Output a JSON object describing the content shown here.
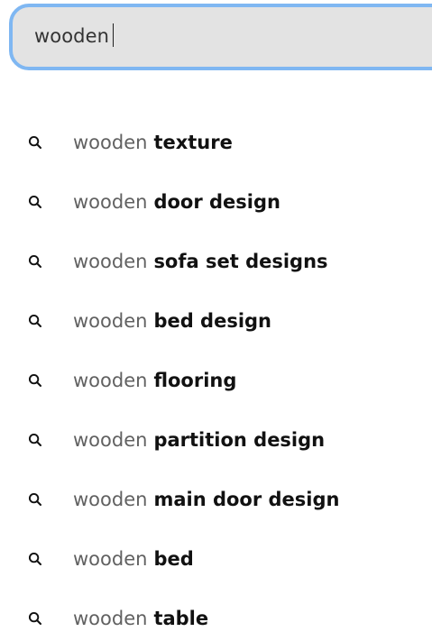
{
  "search": {
    "value": "wooden"
  },
  "suggestions": [
    {
      "prefix": "wooden",
      "completion": "texture"
    },
    {
      "prefix": "wooden",
      "completion": "door design"
    },
    {
      "prefix": "wooden",
      "completion": "sofa set designs"
    },
    {
      "prefix": "wooden",
      "completion": "bed design"
    },
    {
      "prefix": "wooden",
      "completion": "flooring"
    },
    {
      "prefix": "wooden",
      "completion": "partition design"
    },
    {
      "prefix": "wooden",
      "completion": "main door design"
    },
    {
      "prefix": "wooden",
      "completion": "bed"
    },
    {
      "prefix": "wooden",
      "completion": "table"
    }
  ],
  "icons": {
    "suggestion_icon": "search-icon"
  },
  "colors": {
    "search_border": "#7fb7f2",
    "search_background": "#e3e3e3",
    "prefix_text": "#616161",
    "completion_text": "#111111"
  }
}
